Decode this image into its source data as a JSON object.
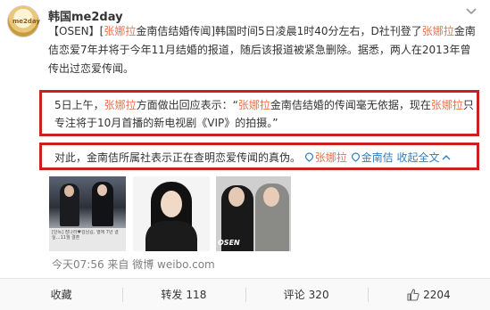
{
  "post": {
    "username": "韩国me2day",
    "avatar_text": "me2day",
    "paragraph1": [
      {
        "text": "【OSEN】",
        "style": "plain"
      },
      {
        "text": "[",
        "style": "plain"
      },
      {
        "text": "张娜拉",
        "style": "name"
      },
      {
        "text": "金南佶结婚传闻]韩国时间5日凌晨1时40分左右，D社刊登了",
        "style": "plain"
      },
      {
        "text": "张娜拉",
        "style": "name"
      },
      {
        "text": "金南佶恋爱7年并将于今年11月结婚的报道，随后该报道被紧急删除。据悉，两人在2013年曾传出过恋爱传闻。",
        "style": "plain"
      }
    ],
    "paragraph2": [
      {
        "text": "5日上午，",
        "style": "plain"
      },
      {
        "text": "张娜拉",
        "style": "name"
      },
      {
        "text": "方面做出回应表示：“",
        "style": "plain"
      },
      {
        "text": "张娜拉",
        "style": "name"
      },
      {
        "text": "金南佶结婚的传闻毫无依据，现在",
        "style": "plain"
      },
      {
        "text": "张娜拉",
        "style": "name"
      },
      {
        "text": "只专注将于10月首播的新电视剧《VIP》的拍摄。”",
        "style": "plain"
      }
    ],
    "paragraph3": {
      "text": "对此，金南佶所属社表示正在查明恋爱传闻的真伪。",
      "tag1": "张娜拉",
      "tag2": "金南佶",
      "expand": "收起全文",
      "expand_icon": "chevron-up-icon"
    },
    "thumb1_caption": "[단독] 장나라♥김남길, 열애 7년 결실…11월 결혼",
    "thumb3_watermark": "OSEN",
    "meta": "今天07:56 来自 微博 weibo.com"
  },
  "actions": {
    "collect": "收藏",
    "repost_label": "转发",
    "repost_count": "118",
    "comment_label": "评论",
    "comment_count": "320",
    "like_count": "2204"
  },
  "colors": {
    "name_link": "#eb7350",
    "highlight_box": "#cc1f1f",
    "meta_text": "#808080"
  }
}
